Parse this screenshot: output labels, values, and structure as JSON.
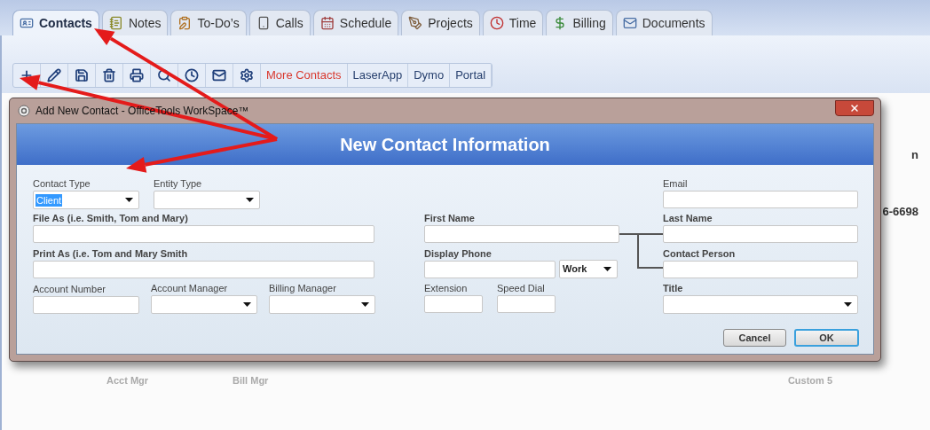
{
  "tabs": [
    {
      "label": "Contacts",
      "selected": true
    },
    {
      "label": "Notes",
      "selected": false
    },
    {
      "label": "To-Do’s",
      "selected": false
    },
    {
      "label": "Calls",
      "selected": false
    },
    {
      "label": "Schedule",
      "selected": false
    },
    {
      "label": "Projects",
      "selected": false
    },
    {
      "label": "Time",
      "selected": false
    },
    {
      "label": "Billing",
      "selected": false
    },
    {
      "label": "Documents",
      "selected": false
    }
  ],
  "toolbar": [
    {
      "kind": "icon"
    },
    {
      "kind": "icon"
    },
    {
      "kind": "icon"
    },
    {
      "kind": "icon"
    },
    {
      "kind": "icon"
    },
    {
      "kind": "icon"
    },
    {
      "kind": "icon"
    },
    {
      "kind": "icon"
    },
    {
      "kind": "icon"
    },
    {
      "kind": "text",
      "label": "More Contacts",
      "accent": true
    },
    {
      "kind": "text",
      "label": "LaserApp",
      "accent": false
    },
    {
      "kind": "text",
      "label": "Dymo",
      "accent": false
    },
    {
      "kind": "text",
      "label": "Portal",
      "accent": false
    }
  ],
  "background": {
    "right_texts": [
      "n",
      "6-6698"
    ],
    "bottom_texts": [
      "Acct Mgr",
      "Bill Mgr",
      "Custom 5"
    ]
  },
  "dialog": {
    "title": "Add New Contact - OfficeTools WorkSpace™",
    "heading": "New Contact Information",
    "rows": [
      {
        "left": [
          {
            "label": "Contact Type",
            "bold": false,
            "kind": "dropdown",
            "value": "Client",
            "value_selected": true
          },
          {
            "label": "Entity Type",
            "bold": false,
            "kind": "dropdown"
          }
        ],
        "middle": [],
        "right": [
          {
            "label": "Email",
            "bold": false,
            "kind": "widefield"
          }
        ]
      },
      {
        "left": [
          {
            "label": "File As (i.e. Smith, Tom and Mary)",
            "bold": true,
            "kind": "widefield"
          }
        ],
        "middle": [
          {
            "label": "First Name",
            "bold": true,
            "kind": "widefield"
          }
        ],
        "right": [
          {
            "label": "Last Name",
            "bold": true,
            "kind": "widefield"
          }
        ]
      },
      {
        "left": [
          {
            "label": "Print As (i.e. Tom and Mary Smith",
            "bold": true,
            "kind": "widefield"
          }
        ],
        "middle": [
          {
            "label": "Display Phone",
            "bold": true,
            "kind": "phonefield"
          },
          {
            "kind": "smalldropdown",
            "value": "Work",
            "value_selected": false
          }
        ],
        "right": [
          {
            "label": "Contact Person",
            "bold": true,
            "kind": "widefield"
          }
        ]
      },
      {
        "left": [
          {
            "label": "Account Number",
            "bold": false,
            "kind": "field"
          },
          {
            "label": "Account Manager",
            "bold": false,
            "kind": "dropdown"
          },
          {
            "label": "Billing Manager",
            "bold": false,
            "kind": "dropdown"
          }
        ],
        "middle": [
          {
            "label": "Extension",
            "bold": false,
            "kind": "smallfield"
          },
          {
            "label": "Speed Dial",
            "bold": false,
            "kind": "smallfield"
          }
        ],
        "right": [
          {
            "label": "Title",
            "bold": true,
            "kind": "widedropdown"
          }
        ]
      }
    ],
    "buttons": [
      {
        "label": "Cancel",
        "default": false
      },
      {
        "label": "OK",
        "default": true
      }
    ]
  }
}
